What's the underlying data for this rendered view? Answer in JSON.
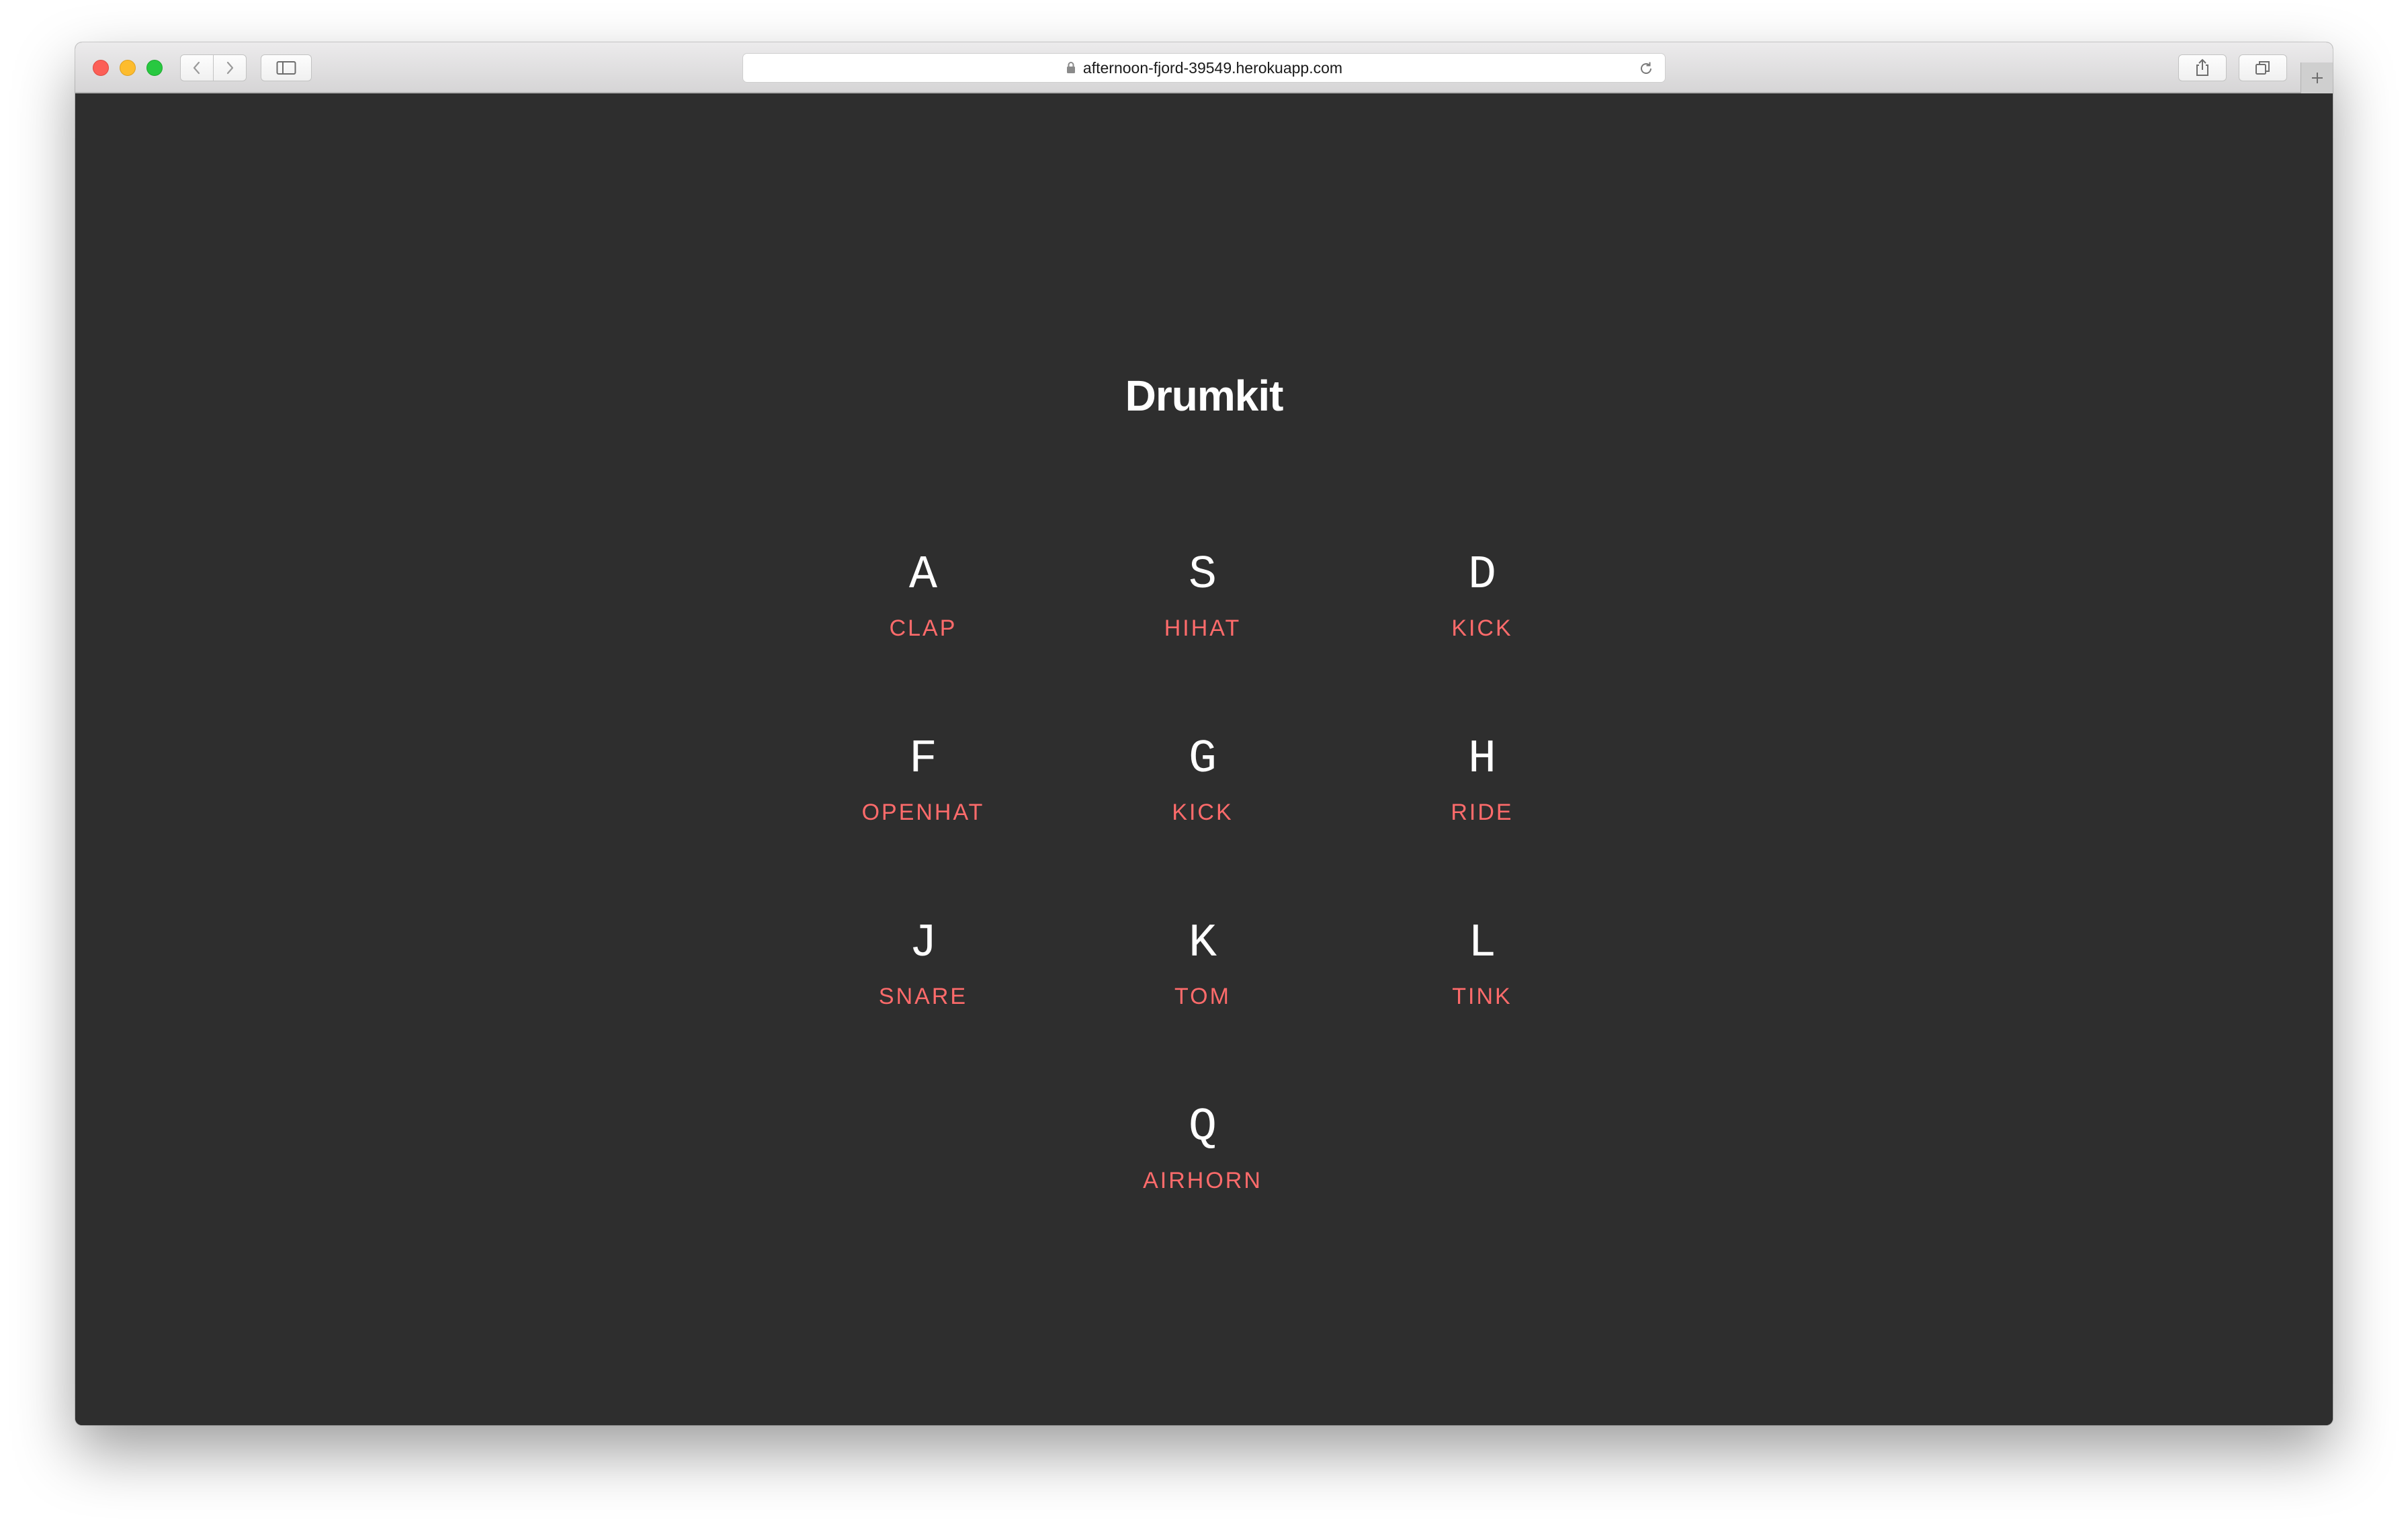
{
  "browser": {
    "url": "afternoon-fjord-39549.herokuapp.com"
  },
  "page": {
    "title": "Drumkit"
  },
  "keys": [
    {
      "letter": "A",
      "sound": "CLAP"
    },
    {
      "letter": "S",
      "sound": "HIHAT"
    },
    {
      "letter": "D",
      "sound": "KICK"
    },
    {
      "letter": "F",
      "sound": "OPENHAT"
    },
    {
      "letter": "G",
      "sound": "KICK"
    },
    {
      "letter": "H",
      "sound": "RIDE"
    },
    {
      "letter": "J",
      "sound": "SNARE"
    },
    {
      "letter": "K",
      "sound": "TOM"
    },
    {
      "letter": "L",
      "sound": "TINK"
    },
    {
      "letter": "Q",
      "sound": "AIRHORN"
    }
  ],
  "colors": {
    "background": "#2e2e2e",
    "letter": "#ffffff",
    "sound": "#ff6b6b"
  }
}
